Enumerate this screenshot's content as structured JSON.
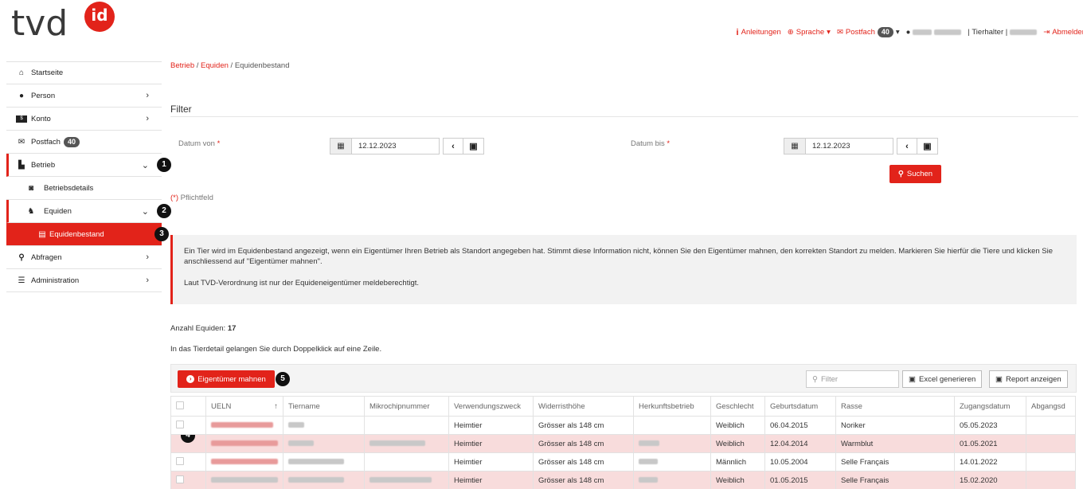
{
  "logo": {
    "text": "tvd",
    "badge": "id"
  },
  "topnav": {
    "anleitungen": "Anleitungen",
    "sprache": "Sprache",
    "postfach": "Postfach",
    "postfach_count": "40",
    "role_text": "| Tierhalter |",
    "abmelden": "Abmelden"
  },
  "sidebar": {
    "items": [
      {
        "label": "Startseite",
        "icon": "home-icon"
      },
      {
        "label": "Person",
        "icon": "user-icon"
      },
      {
        "label": "Konto",
        "icon": "account-icon"
      },
      {
        "label": "Postfach",
        "icon": "mail-icon",
        "badge": "40"
      },
      {
        "label": "Betrieb",
        "icon": "industry-icon"
      },
      {
        "label": "Betriebsdetails",
        "icon": "doc-search-icon"
      },
      {
        "label": "Equiden",
        "icon": "horse-icon"
      },
      {
        "label": "Equidenbestand",
        "icon": "list-icon"
      },
      {
        "label": "Abfragen",
        "icon": "search-icon"
      },
      {
        "label": "Administration",
        "icon": "sliders-icon"
      }
    ]
  },
  "markers": [
    "1",
    "2",
    "3",
    "4",
    "5"
  ],
  "breadcrumb": {
    "b1": "Betrieb",
    "sep": "/",
    "b2": "Equiden",
    "b3": "Equidenbestand"
  },
  "filter": {
    "title": "Filter",
    "datum_von_label": "Datum von",
    "datum_bis_label": "Datum bis",
    "required_mark": "*",
    "datum_von": "12.12.2023",
    "datum_bis": "12.12.2023",
    "search_button": "Suchen",
    "pflichtfeld_mark": "(*)",
    "pflichtfeld": "Pflichtfeld"
  },
  "info": {
    "p1": "Ein Tier wird im Equidenbestand angezeigt, wenn ein Eigentümer Ihren Betrieb als Standort angegeben hat. Stimmt diese Information nicht, können Sie den Eigentümer mahnen, den korrekten Standort zu melden. Markieren Sie hierfür die Tiere und klicken Sie anschliessend auf \"Eigentümer mahnen\".",
    "p2": "Laut TVD-Verordnung ist nur der Equideneigentümer meldeberechtigt."
  },
  "count_label": "Anzahl Equiden:",
  "count_value": "17",
  "hint": "In das Tierdetail gelangen Sie durch Doppelklick auf eine Zeile.",
  "toolbar": {
    "mahnen": "Eigentümer mahnen",
    "filter_placeholder": "Filter",
    "excel": "Excel generieren",
    "report": "Report anzeigen"
  },
  "table": {
    "headers": [
      "UELN",
      "Tiername",
      "Mikrochipnummer",
      "Verwendungszweck",
      "Widerristhöhe",
      "Herkunftsbetrieb",
      "Geschlecht",
      "Geburtsdatum",
      "Rasse",
      "Zugangsdatum",
      "Abgangsd"
    ],
    "sort_indicator": "↑",
    "rows": [
      {
        "verwendung": "Heimtier",
        "hoehe": "Grösser als 148 cm",
        "geschlecht": "Weiblich",
        "geburt": "06.04.2015",
        "rasse": "Noriker",
        "zugang": "05.05.2023"
      },
      {
        "verwendung": "Heimtier",
        "hoehe": "Grösser als 148 cm",
        "geschlecht": "Weiblich",
        "geburt": "12.04.2014",
        "rasse": "Warmblut",
        "zugang": "01.05.2021"
      },
      {
        "verwendung": "Heimtier",
        "hoehe": "Grösser als 148 cm",
        "geschlecht": "Männlich",
        "geburt": "10.05.2004",
        "rasse": "Selle Français",
        "zugang": "14.01.2022"
      },
      {
        "verwendung": "Heimtier",
        "hoehe": "Grösser als 148 cm",
        "geschlecht": "Weiblich",
        "geburt": "01.05.2015",
        "rasse": "Selle Français",
        "zugang": "15.02.2020"
      }
    ]
  },
  "colors": {
    "accent": "#e2231a",
    "row_highlight": "#f8dcdc",
    "info_bg": "#f2f2f2"
  }
}
